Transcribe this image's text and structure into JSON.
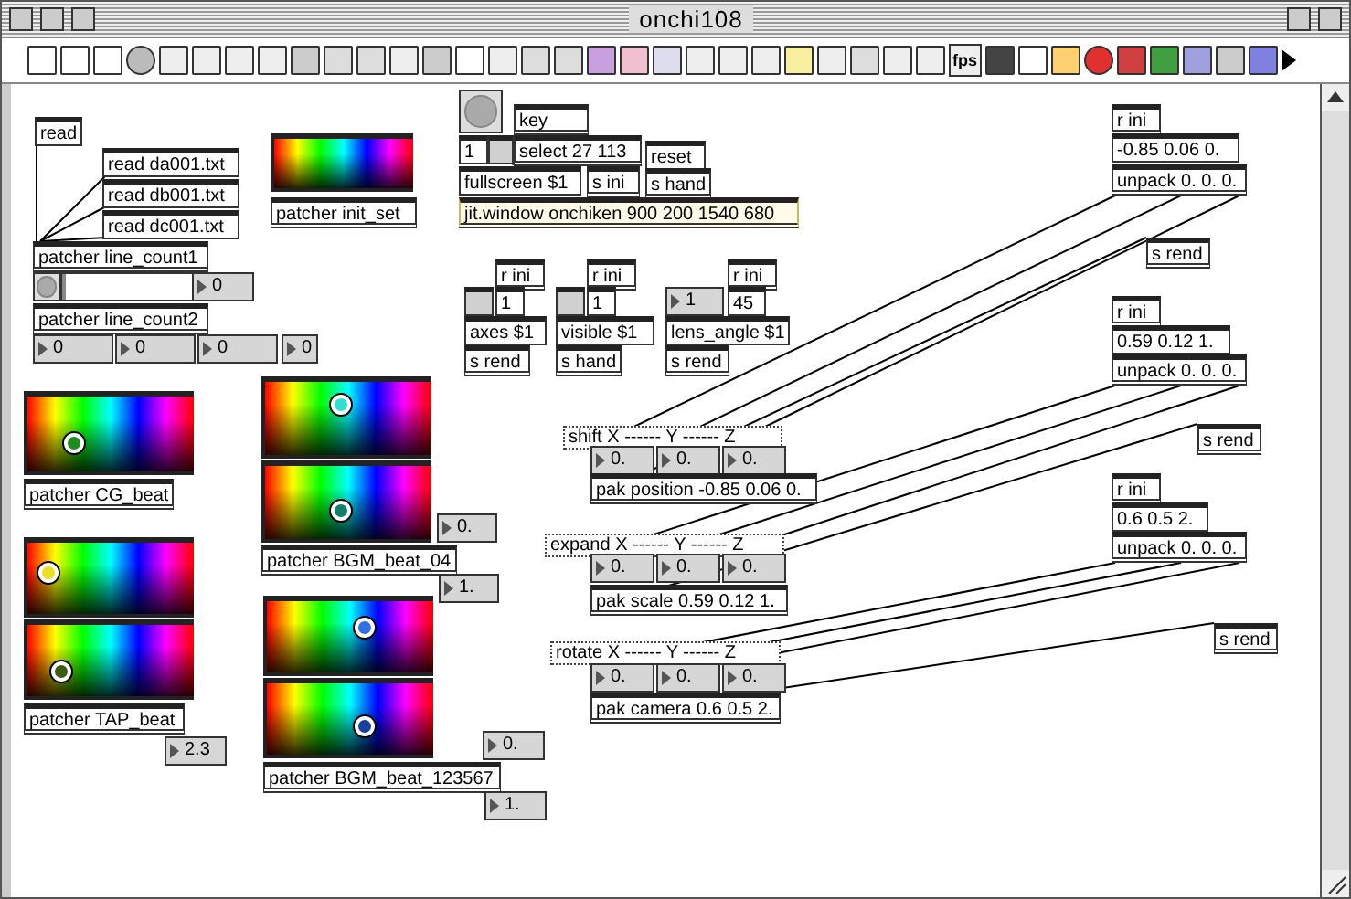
{
  "window": {
    "title": "onchi108"
  },
  "toolbar": {
    "fps_label": "fps"
  },
  "nodes": [
    {
      "kind": "message",
      "text": "read"
    },
    {
      "kind": "message",
      "text": "read da001.txt"
    },
    {
      "kind": "message",
      "text": "read db001.txt"
    },
    {
      "kind": "message",
      "text": "read dc001.txt"
    },
    {
      "kind": "swatch"
    },
    {
      "kind": "object",
      "text": "patcher init_set"
    },
    {
      "kind": "object",
      "text": "patcher line_count1"
    },
    {
      "kind": "button"
    },
    {
      "kind": "slider",
      "level": 0
    },
    {
      "kind": "number",
      "text": "0"
    },
    {
      "kind": "object",
      "text": "patcher line_count2"
    },
    {
      "kind": "number",
      "text": "0"
    },
    {
      "kind": "number",
      "text": "0"
    },
    {
      "kind": "number",
      "text": "0"
    },
    {
      "kind": "number",
      "text": "0"
    },
    {
      "kind": "swatch",
      "color": "#1e8c1e"
    },
    {
      "kind": "object",
      "text": "patcher CG_beat"
    },
    {
      "kind": "swatch",
      "color": "#e8e020"
    },
    {
      "kind": "swatch",
      "color": "#3c5a14"
    },
    {
      "kind": "object",
      "text": "patcher TAP_beat"
    },
    {
      "kind": "number",
      "text": "2.3"
    },
    {
      "kind": "swatch",
      "color": "#30e0d0"
    },
    {
      "kind": "swatch",
      "color": "#10806a"
    },
    {
      "kind": "object",
      "text": "patcher BGM_beat_04"
    },
    {
      "kind": "number",
      "text": "0."
    },
    {
      "kind": "number",
      "text": "1."
    },
    {
      "kind": "swatch",
      "color": "#3070e0"
    },
    {
      "kind": "swatch",
      "color": "#1840a0"
    },
    {
      "kind": "object",
      "text": "patcher BGM_beat_123567"
    },
    {
      "kind": "number",
      "text": "0."
    },
    {
      "kind": "number",
      "text": "1."
    },
    {
      "kind": "button"
    },
    {
      "kind": "object",
      "text": "key"
    },
    {
      "kind": "message",
      "text": "1"
    },
    {
      "kind": "toggle",
      "checked": false
    },
    {
      "kind": "object",
      "text": "select 27 113"
    },
    {
      "kind": "message",
      "text": "reset"
    },
    {
      "kind": "message",
      "text": "fullscreen $1"
    },
    {
      "kind": "object",
      "text": "s ini"
    },
    {
      "kind": "object",
      "text": "s hand"
    },
    {
      "kind": "object",
      "text": "jit.window onchiken 900 200 1540 680"
    },
    {
      "kind": "object",
      "text": "r ini"
    },
    {
      "kind": "toggle",
      "checked": false
    },
    {
      "kind": "message",
      "text": "1"
    },
    {
      "kind": "message",
      "text": "axes $1"
    },
    {
      "kind": "object",
      "text": "s rend"
    },
    {
      "kind": "object",
      "text": "r ini"
    },
    {
      "kind": "toggle",
      "checked": false
    },
    {
      "kind": "message",
      "text": "1"
    },
    {
      "kind": "message",
      "text": "visible $1"
    },
    {
      "kind": "object",
      "text": "s hand"
    },
    {
      "kind": "object",
      "text": "r ini"
    },
    {
      "kind": "number",
      "text": "1"
    },
    {
      "kind": "message",
      "text": "45"
    },
    {
      "kind": "message",
      "text": "lens_angle $1"
    },
    {
      "kind": "object",
      "text": "s rend"
    },
    {
      "kind": "comment",
      "text": "shift X ------ Y ------ Z"
    },
    {
      "kind": "number",
      "text": "0."
    },
    {
      "kind": "number",
      "text": "0."
    },
    {
      "kind": "number",
      "text": "0."
    },
    {
      "kind": "object",
      "text": "pak position -0.85 0.06 0."
    },
    {
      "kind": "comment",
      "text": "expand X ------ Y ------ Z"
    },
    {
      "kind": "number",
      "text": "0."
    },
    {
      "kind": "number",
      "text": "0."
    },
    {
      "kind": "number",
      "text": "0."
    },
    {
      "kind": "object",
      "text": "pak scale 0.59 0.12 1."
    },
    {
      "kind": "comment",
      "text": "rotate X ------ Y ------ Z"
    },
    {
      "kind": "number",
      "text": "0."
    },
    {
      "kind": "number",
      "text": "0."
    },
    {
      "kind": "number",
      "text": "0."
    },
    {
      "kind": "object",
      "text": "pak camera 0.6 0.5 2."
    },
    {
      "kind": "object",
      "text": "r ini"
    },
    {
      "kind": "message",
      "text": "-0.85 0.06 0."
    },
    {
      "kind": "object",
      "text": "unpack 0. 0. 0."
    },
    {
      "kind": "object",
      "text": "s rend"
    },
    {
      "kind": "object",
      "text": "r ini"
    },
    {
      "kind": "message",
      "text": "0.59 0.12 1."
    },
    {
      "kind": "object",
      "text": "unpack 0. 0. 0."
    },
    {
      "kind": "object",
      "text": "s rend"
    },
    {
      "kind": "object",
      "text": "r ini"
    },
    {
      "kind": "message",
      "text": "0.6 0.5 2."
    },
    {
      "kind": "object",
      "text": "unpack 0. 0. 0."
    },
    {
      "kind": "object",
      "text": "s rend"
    }
  ]
}
